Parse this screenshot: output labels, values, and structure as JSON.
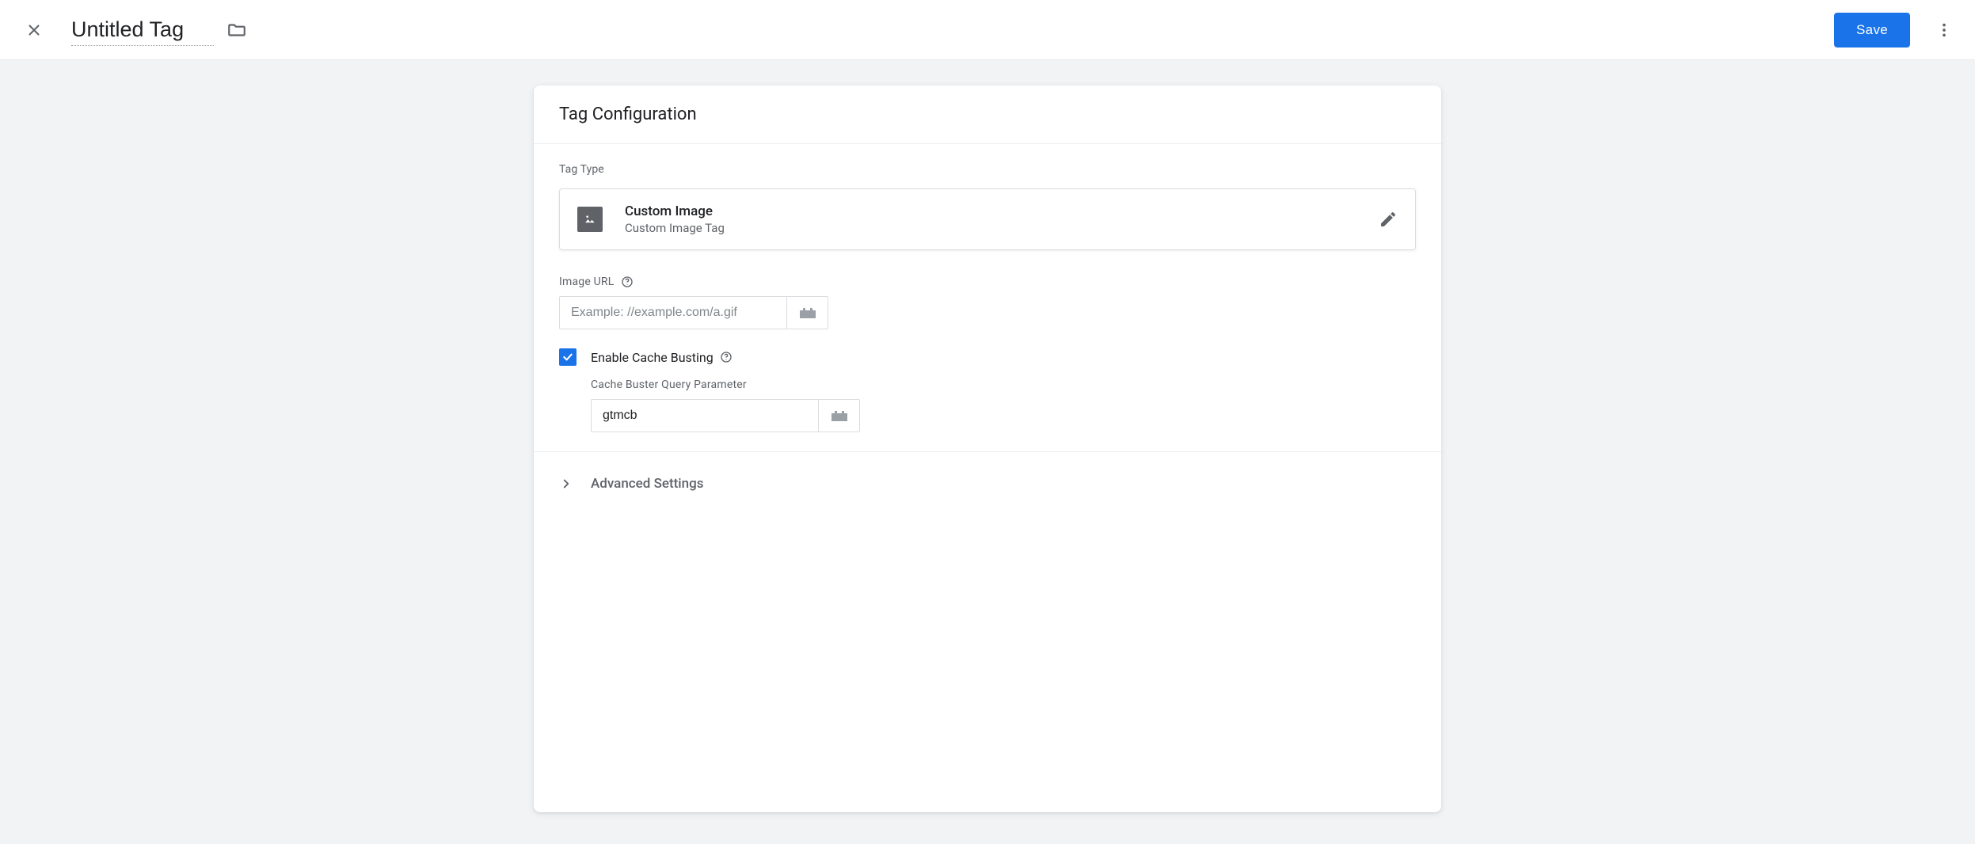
{
  "header": {
    "title_value": "Untitled Tag",
    "save_label": "Save"
  },
  "card": {
    "title": "Tag Configuration",
    "tag_type_label": "Tag Type",
    "selected": {
      "title": "Custom Image",
      "subtitle": "Custom Image Tag"
    },
    "image_url": {
      "label": "Image URL",
      "placeholder": "Example: //example.com/a.gif",
      "value": ""
    },
    "cache_busting": {
      "checked": true,
      "label": "Enable Cache Busting",
      "param_label": "Cache Buster Query Parameter",
      "param_value": "gtmcb"
    },
    "advanced_label": "Advanced Settings"
  }
}
